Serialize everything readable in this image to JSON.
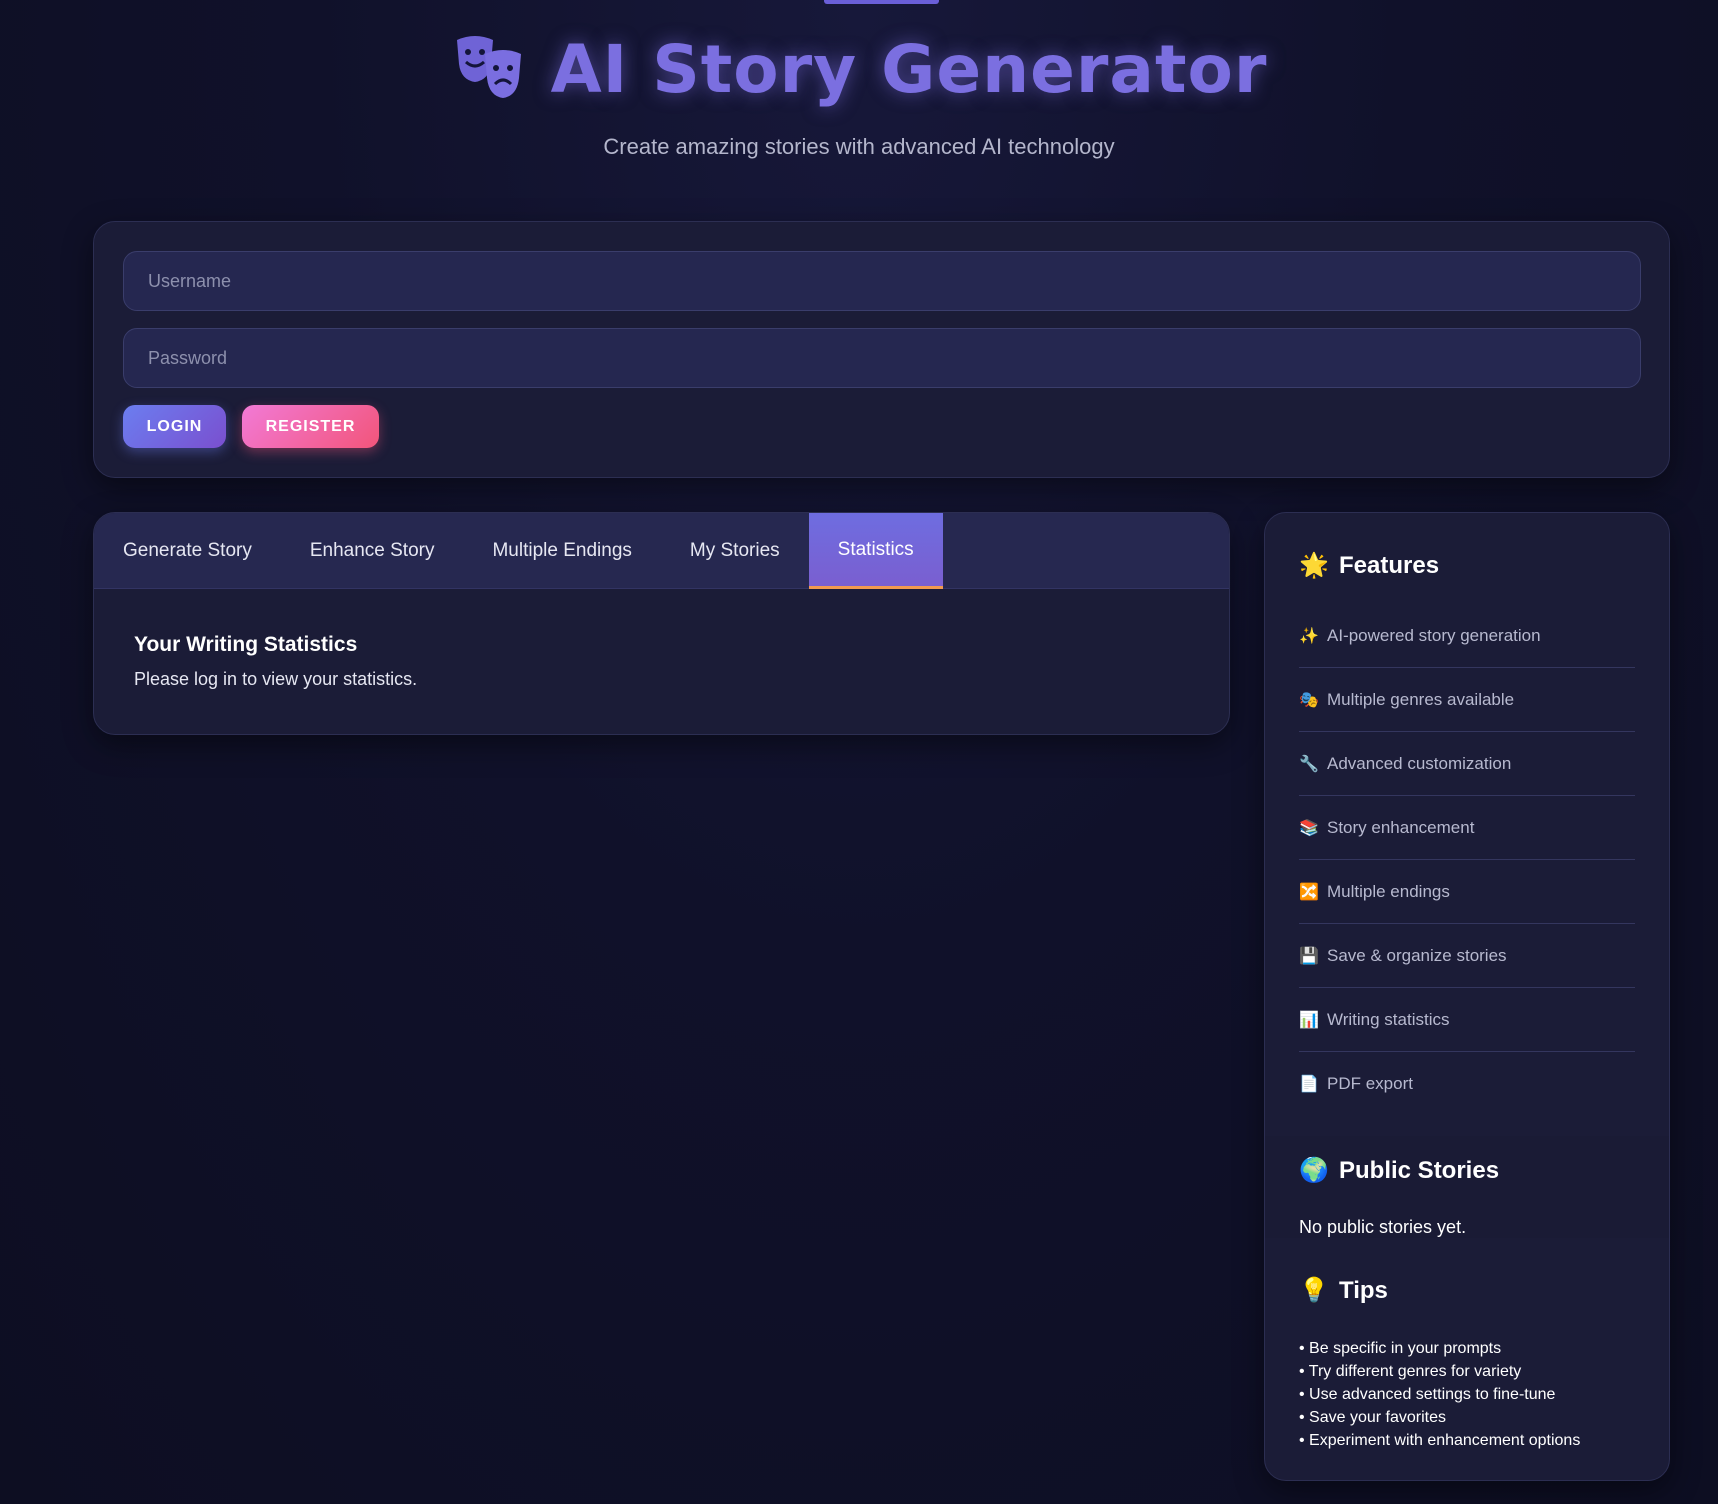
{
  "header": {
    "title": "AI Story Generator",
    "subtitle": "Create amazing stories with advanced AI technology",
    "icon": "theater-masks-icon"
  },
  "auth": {
    "username_placeholder": "Username",
    "username_value": "",
    "password_placeholder": "Password",
    "password_value": "",
    "login_label": "LOGIN",
    "register_label": "REGISTER"
  },
  "tabs": [
    {
      "label": "Generate Story",
      "active": false
    },
    {
      "label": "Enhance Story",
      "active": false
    },
    {
      "label": "Multiple Endings",
      "active": false
    },
    {
      "label": "My Stories",
      "active": false
    },
    {
      "label": "Statistics",
      "active": true
    }
  ],
  "statistics": {
    "title": "Your Writing Statistics",
    "message": "Please log in to view your statistics."
  },
  "sidebar": {
    "features": {
      "emoji": "🌟",
      "title": "Features",
      "items": [
        {
          "icon": "✨",
          "label": "AI-powered story generation"
        },
        {
          "icon": "🎭",
          "label": "Multiple genres available"
        },
        {
          "icon": "🔧",
          "label": "Advanced customization"
        },
        {
          "icon": "📚",
          "label": "Story enhancement"
        },
        {
          "icon": "🔀",
          "label": "Multiple endings"
        },
        {
          "icon": "💾",
          "label": "Save & organize stories"
        },
        {
          "icon": "📊",
          "label": "Writing statistics"
        },
        {
          "icon": "📄",
          "label": "PDF export"
        }
      ]
    },
    "public_stories": {
      "emoji": "🌍",
      "title": "Public Stories",
      "empty_text": "No public stories yet."
    },
    "tips": {
      "emoji": "💡",
      "title": "Tips",
      "items": [
        "Be specific in your prompts",
        "Try different genres for variety",
        "Use advanced settings to fine-tune",
        "Save your favorites",
        "Experiment with enhancement options"
      ]
    }
  },
  "colors": {
    "accent": "#7b6fe0",
    "background": "#0f1025",
    "card": "#1b1c37",
    "tab_active_underline": "#f29a4f",
    "register_gradient_start": "#f27ad6",
    "register_gradient_end": "#f2557a"
  }
}
